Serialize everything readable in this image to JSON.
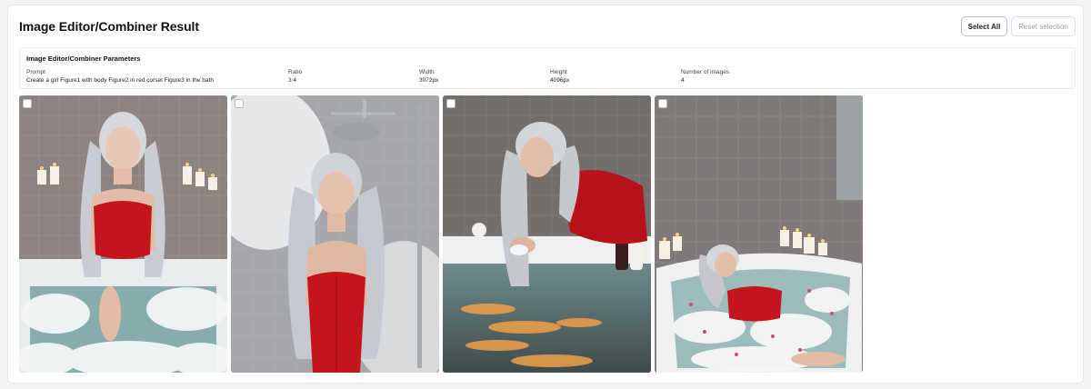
{
  "header": {
    "title": "Image Editor/Combiner Result",
    "select_all_label": "Select All",
    "reset_label": "Reset selection"
  },
  "params": {
    "title": "Image Editor/Combiner Parameters",
    "fields": [
      {
        "label": "Prompt",
        "value": "Create a girl Figure1 with body Figure2 in red corset Figure3 in the bath"
      },
      {
        "label": "Ratio",
        "value": "3:4"
      },
      {
        "label": "Width",
        "value": "3072px"
      },
      {
        "label": "Height",
        "value": "4096px"
      },
      {
        "label": "Number of images",
        "value": "4"
      }
    ]
  },
  "images": [
    {
      "selected": false
    },
    {
      "selected": false
    },
    {
      "selected": false
    },
    {
      "selected": false
    }
  ],
  "colors": {
    "accent_border": "#c8b8e4",
    "corset_red": "#c4141c",
    "tile_gray": "#8c8380",
    "water": "#8fb3b2"
  }
}
